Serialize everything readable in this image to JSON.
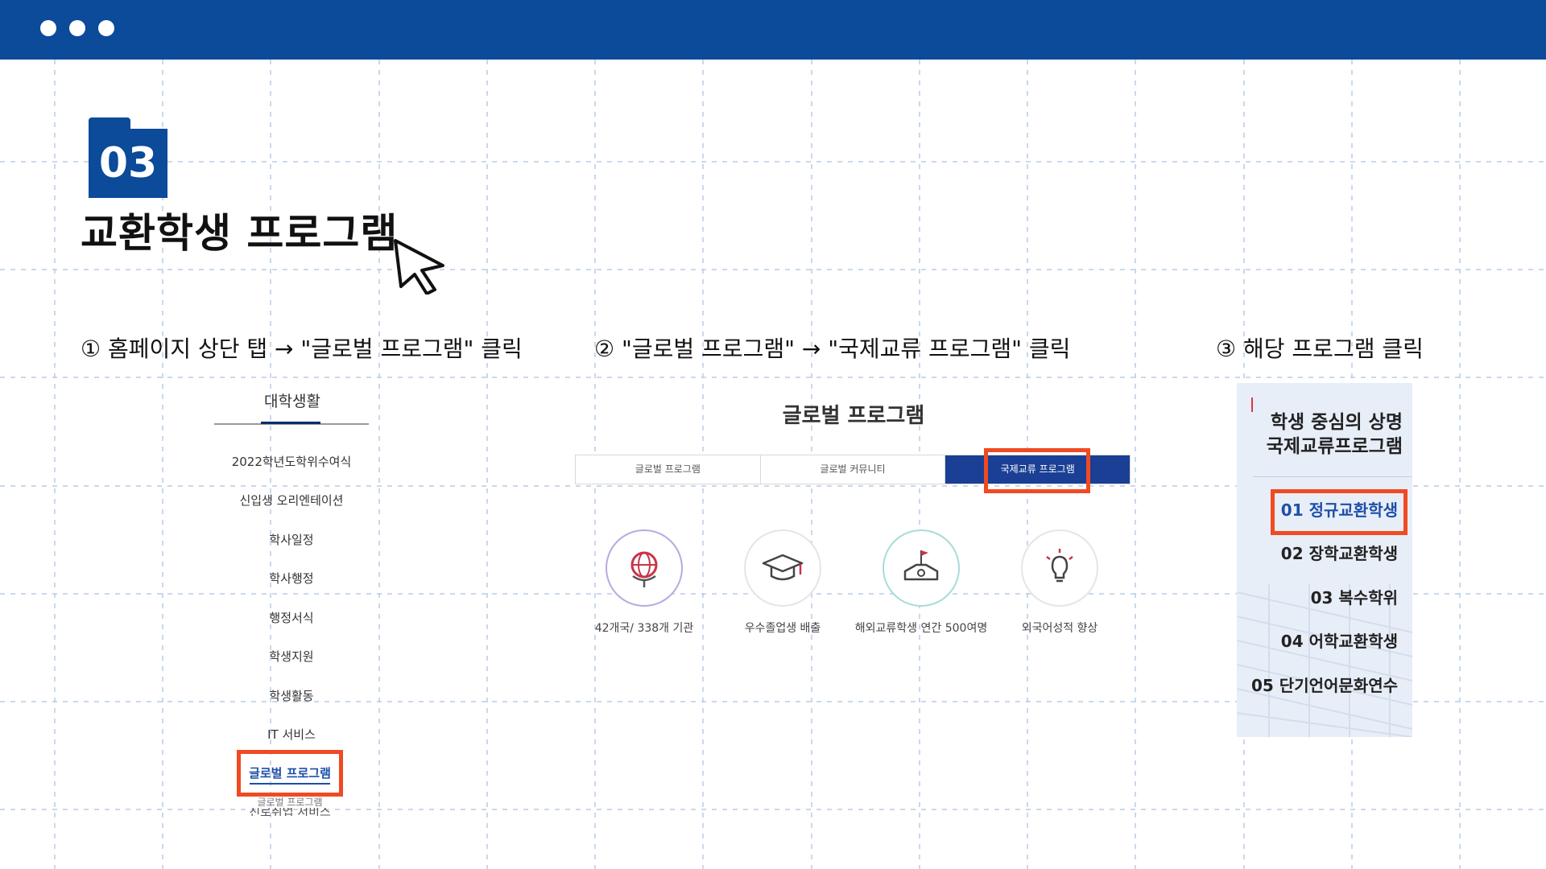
{
  "window": {
    "accent": "#0c4a9a",
    "highlight": "#f04a23"
  },
  "section": {
    "number": "03",
    "title": "교환학생 프로그램"
  },
  "steps": [
    {
      "text": "① 홈페이지 상단 탭 → \"글로벌 프로그램\" 클릭"
    },
    {
      "text": "② \"글로벌 프로그램\" → \"국제교류 프로그램\" 클릭"
    },
    {
      "text": "③ 해당 프로그램 클릭"
    }
  ],
  "panel1": {
    "header": "대학생활",
    "items": [
      {
        "label": "2022학년도학위수여식"
      },
      {
        "label": "신입생 오리엔테이션"
      },
      {
        "label": "학사일정"
      },
      {
        "label": "학사행정"
      },
      {
        "label": "행정서식"
      },
      {
        "label": "학생지원"
      },
      {
        "label": "학생활동"
      },
      {
        "label": "IT 서비스"
      }
    ],
    "active": "글로벌 프로그램",
    "sub": "글로벌 프로그램",
    "next": "진로취업 서비스"
  },
  "panel2": {
    "title": "글로벌 프로그램",
    "tabs": [
      {
        "label": "글로벌 프로그램"
      },
      {
        "label": "글로벌 커뮤니티"
      },
      {
        "label": "국제교류 프로그램"
      }
    ],
    "features": [
      {
        "caption": "42개국/ 338개 기관",
        "icon": "globe-icon"
      },
      {
        "caption": "우수졸업생 배출",
        "icon": "graduation-cap-icon"
      },
      {
        "caption": "해외교류학생 연간 500여명",
        "icon": "podium-flag-icon"
      },
      {
        "caption": "외국어성적 향상",
        "icon": "lightbulb-icon"
      }
    ]
  },
  "panel3": {
    "title_line1": "학생 중심의 상명",
    "title_line2": "국제교류프로그램",
    "items": [
      {
        "label": "01 정규교환학생"
      },
      {
        "label": "02 장학교환학생"
      },
      {
        "label": "03 복수학위"
      },
      {
        "label": "04 어학교환학생"
      },
      {
        "label": "05 단기언어문화연수"
      }
    ]
  }
}
